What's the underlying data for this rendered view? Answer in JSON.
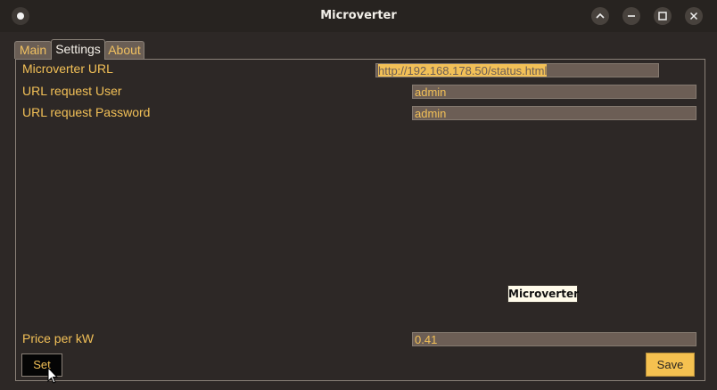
{
  "window": {
    "title": "Microverter",
    "controls": {
      "minimize_icon": "⌃",
      "restore_icon": "−",
      "maximize_icon": "□",
      "close_icon": "✕"
    }
  },
  "tabs": [
    {
      "label": "Main",
      "active": false
    },
    {
      "label": "Settings",
      "active": true
    },
    {
      "label": "About",
      "active": false
    }
  ],
  "settings": {
    "url_label": "Microverter URL",
    "url_value": "http://192.168.178.50/status.html",
    "user_label": "URL request User",
    "user_value": "admin",
    "password_label": "URL request Password",
    "password_value": "admin",
    "price_label": "Price per kW",
    "price_value": "0.41",
    "set_label": "Set",
    "save_label": "Save"
  },
  "tooltip": "Microverter",
  "colors": {
    "accent": "#f2c057",
    "background": "#2d2826",
    "field": "#6c5e55"
  }
}
